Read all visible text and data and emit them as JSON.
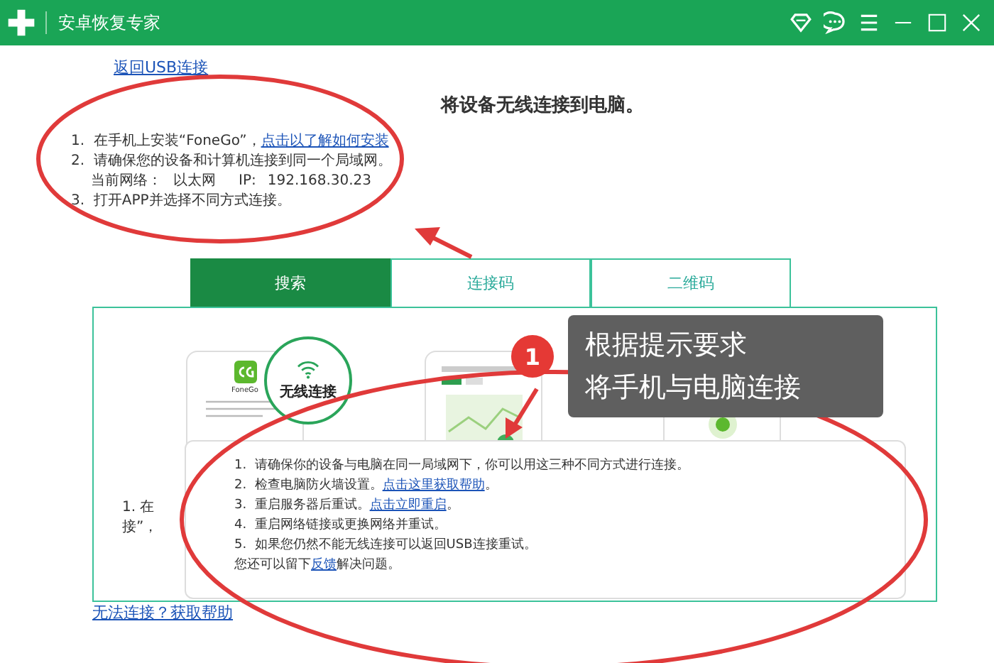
{
  "window": {
    "title": "安卓恢复专家"
  },
  "back_link": "返回USB连接",
  "heading": "将设备无线连接到电脑。",
  "steps": [
    {
      "number": "1.",
      "text": "在手机上安装“FoneGo”，",
      "link": "点击以了解如何安装"
    },
    {
      "number": "2.",
      "text": "请确保您的设备和计算机连接到同一个局域网。"
    },
    {
      "number": "3.",
      "text": "打开APP并选择不同方式连接。"
    }
  ],
  "network": {
    "label": "当前网络：",
    "value": "以太网",
    "ip_label": "IP:",
    "ip": "192.168.30.23"
  },
  "tabs": [
    {
      "label": "搜索",
      "selected": true
    },
    {
      "label": "连接码",
      "selected": false
    },
    {
      "label": "二维码",
      "selected": false
    }
  ],
  "panel": {
    "app_name": "FoneGo",
    "wireless_label": "无线连接",
    "fragments": [
      "1. 在",
      "接”，"
    ]
  },
  "popup": {
    "items": [
      {
        "number": "1.",
        "text": "请确保你的设备与电脑在同一局域网下，你可以用这三种不同方式进行连接。"
      },
      {
        "number": "2.",
        "text": "检查电脑防火墙设置。",
        "link": "点击这里获取帮助",
        "after": "。"
      },
      {
        "number": "3.",
        "text": "重启服务器后重试。",
        "link": "点击立即重启",
        "after": "。"
      },
      {
        "number": "4.",
        "text": "重启网络链接或更换网络并重试。"
      },
      {
        "number": "5.",
        "text": "如果您仍然不能无线连接可以返回USB连接重试。"
      }
    ],
    "footer": {
      "before": "您还可以留下",
      "link": "反馈",
      "after": "解决问题。"
    }
  },
  "help_link": "无法连接？获取帮助",
  "annotation": {
    "badge": "1",
    "lines": [
      "根据提示要求",
      "将手机与电脑连接"
    ]
  }
}
